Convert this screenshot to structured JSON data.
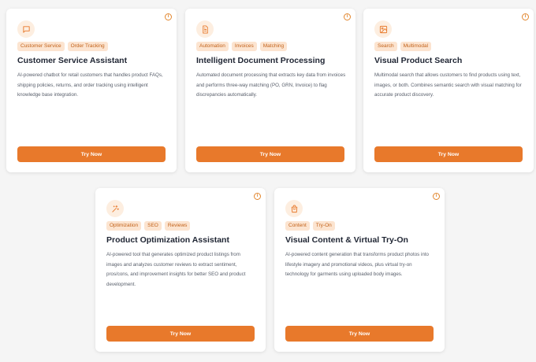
{
  "colors": {
    "accent": "#e8792b",
    "tag_bg": "#fce4d0",
    "tag_text": "#c2621a"
  },
  "cards": [
    {
      "icon": "chat-icon",
      "tags": [
        "Customer Service",
        "Order Tracking"
      ],
      "title": "Customer Service Assistant",
      "description": "AI-powered chatbot for retail customers that handles product FAQs, shipping policies, returns, and order tracking using intelligent knowledge base integration.",
      "button": "Try Now"
    },
    {
      "icon": "document-icon",
      "tags": [
        "Automation",
        "Invoices",
        "Matching"
      ],
      "title": "Intelligent Document Processing",
      "description": "Automated document processing that extracts key data from invoices and performs three-way matching (PO, GRN, Invoice) to flag discrepancies automatically.",
      "button": "Try Now"
    },
    {
      "icon": "image-icon",
      "tags": [
        "Search",
        "Multimodal"
      ],
      "title": "Visual Product Search",
      "description": "Multimodal search that allows customers to find products using text, images, or both. Combines semantic search with visual matching for accurate product discovery.",
      "button": "Try Now"
    },
    {
      "icon": "sparkles-icon",
      "tags": [
        "Optimization",
        "SEO",
        "Reviews"
      ],
      "title": "Product Optimization Assistant",
      "description": "AI-powered tool that generates optimized product listings from images and analyzes customer reviews to extract sentiment, pros/cons, and improvement insights for better SEO and product development.",
      "button": "Try Now"
    },
    {
      "icon": "shopping-bag-icon",
      "tags": [
        "Content",
        "Try-On"
      ],
      "title": "Visual Content & Virtual Try-On",
      "description": "AI-powered content generation that transforms product photos into lifestyle imagery and promotional videos, plus virtual try-on technology for garments using uploaded body images.",
      "button": "Try Now"
    }
  ]
}
